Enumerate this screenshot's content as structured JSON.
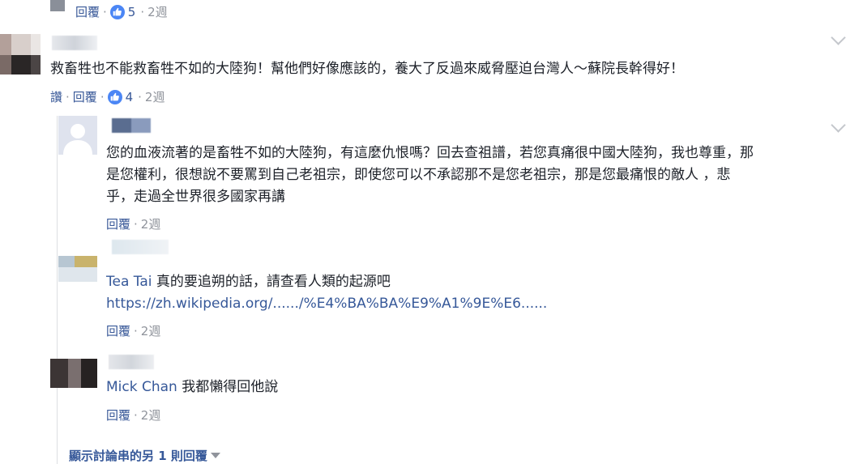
{
  "top_actions": {
    "like": "讚",
    "reply": "回覆",
    "sep": "·",
    "likes": "5",
    "time": "2週"
  },
  "comment1": {
    "text": "救畜牲也不能救畜牲不如的大陸狗！幫他們好像應該的，養大了反過來威脅壓迫台灣人～蘇院長幹得好！",
    "like": "讚",
    "reply": "回覆",
    "sep": "·",
    "likes": "4",
    "time": "2週"
  },
  "reply1": {
    "lines": [
      "您的血液流著的是畜牲不如的大陸狗，有這麼仇恨嗎？回去查祖譜，若您真痛很中國大陸狗，我也尊重，那",
      "是您權利，很想說不要罵到自己老祖宗，即使您可以不承認那不是您老祖宗，那是您最痛恨的敵人 ，悲",
      "乎，走過全世界很多國家再講"
    ],
    "reply": "回覆",
    "sep": "·",
    "time": "2週"
  },
  "reply2": {
    "author": "Tea Tai",
    "text": " 真的要追朔的話，請查看人類的起源吧",
    "link": "https://zh.wikipedia.org/....../%E4%BA%BA%E9%A1%9E%E6......",
    "reply": "回覆",
    "sep": "·",
    "time": "2週"
  },
  "reply3": {
    "author": "Mick Chan",
    "text": " 我都懶得回他說",
    "reply": "回覆",
    "sep": "·",
    "time": "2週"
  },
  "more_replies": "顯示討論串的另 1 則回覆",
  "colors": {
    "link": "#365899",
    "meta": "#90949c",
    "like": "#4b86f5",
    "text": "#1d2129"
  },
  "icons": {
    "like": "thumbs-up-icon",
    "options": "chevron-down-icon",
    "expand": "caret-down-icon"
  }
}
